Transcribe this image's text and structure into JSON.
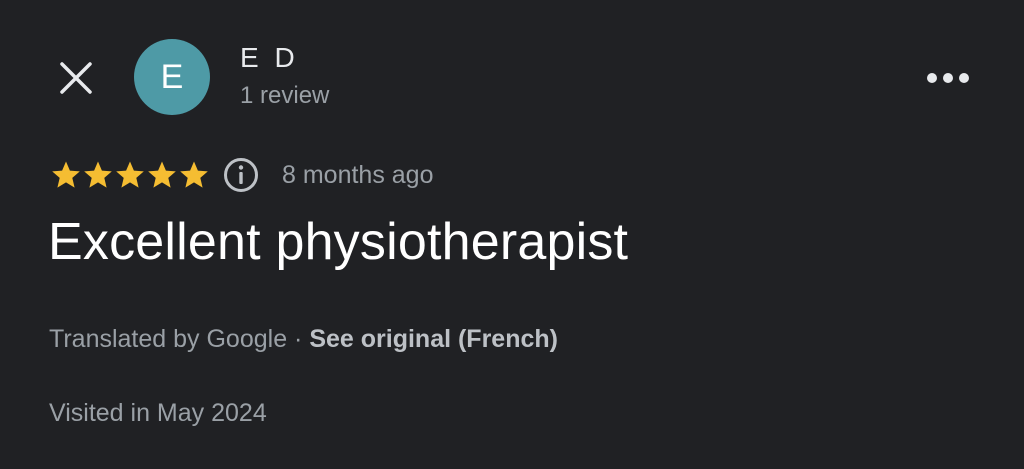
{
  "header": {
    "close_icon": "close-icon",
    "more_icon": "more-horizontal-icon"
  },
  "author": {
    "avatar_letter": "E",
    "avatar_color": "#4e9aa6",
    "name": "E D",
    "reviews": "1 review"
  },
  "review": {
    "rating": 5,
    "max_rating": 5,
    "star_color": "#f5bd32",
    "info_icon": "info-icon",
    "time_ago": "8 months ago",
    "title": "Excellent physiotherapist",
    "translated_by": "Translated by Google",
    "separator": " · ",
    "see_original": "See original (French)",
    "visited": "Visited in May 2024"
  }
}
